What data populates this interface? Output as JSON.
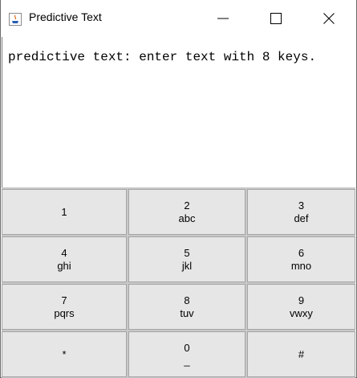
{
  "window": {
    "title": "Predictive Text",
    "minimize_glyph": "—",
    "maximize_glyph": "☐",
    "close_glyph": "✕"
  },
  "editor": {
    "text": "predictive text: enter text with 8 keys."
  },
  "keypad": {
    "keys": [
      {
        "digit": "1",
        "letters": ""
      },
      {
        "digit": "2",
        "letters": "abc"
      },
      {
        "digit": "3",
        "letters": "def"
      },
      {
        "digit": "4",
        "letters": "ghi"
      },
      {
        "digit": "5",
        "letters": "jkl"
      },
      {
        "digit": "6",
        "letters": "mno"
      },
      {
        "digit": "7",
        "letters": "pqrs"
      },
      {
        "digit": "8",
        "letters": "tuv"
      },
      {
        "digit": "9",
        "letters": "vwxy"
      },
      {
        "digit": "*",
        "letters": ""
      },
      {
        "digit": "0",
        "letters": "_"
      },
      {
        "digit": "#",
        "letters": ""
      }
    ]
  }
}
